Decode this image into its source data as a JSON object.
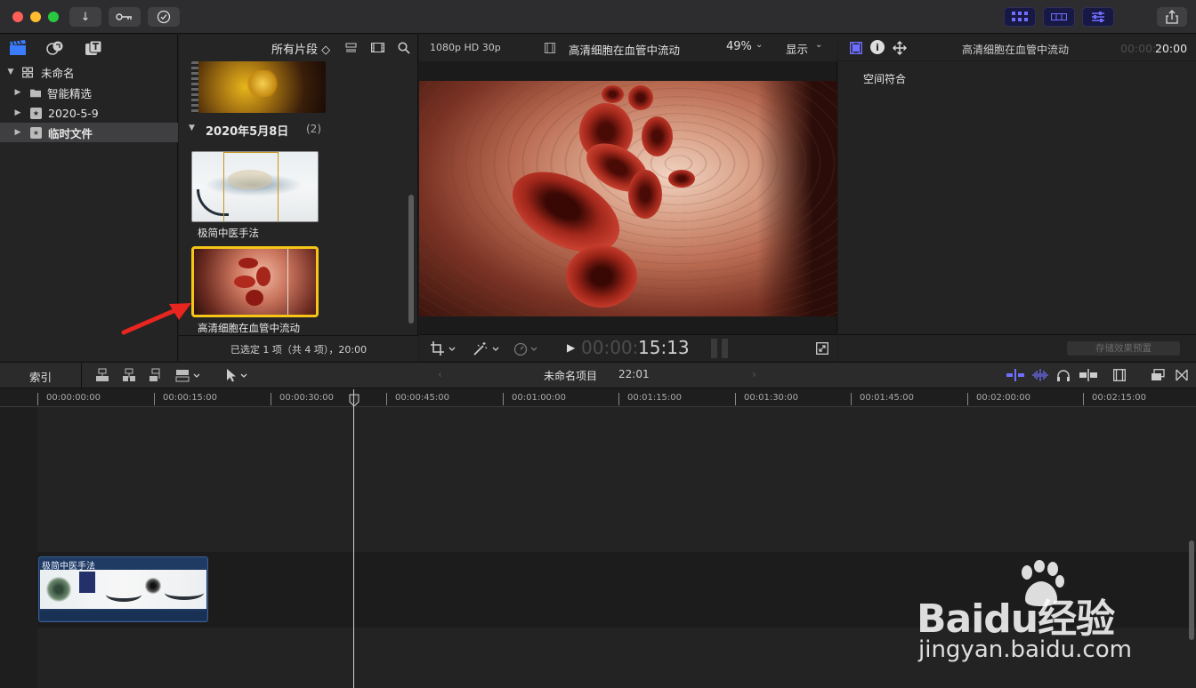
{
  "window": {
    "traffic_colors": [
      "#fe5f57",
      "#febc2e",
      "#28c840"
    ]
  },
  "sidebar": {
    "items": [
      {
        "label": "未命名",
        "icon": "library-grid-icon"
      },
      {
        "label": "智能精选",
        "icon": "folder-icon"
      },
      {
        "label": "2020-5-9",
        "icon": "event-star-icon"
      },
      {
        "label": "临时文件",
        "icon": "event-star-icon"
      }
    ]
  },
  "browser": {
    "filter_label": "所有片段 ◇",
    "date_group": "2020年5月8日",
    "date_group_count": "(2)",
    "clips": [
      {
        "label": "极简中医手法"
      },
      {
        "label": "高清细胞在血管中流动"
      }
    ],
    "status": "已选定 1 项（共 4 项），20:00"
  },
  "viewer": {
    "format": "1080p HD 30p",
    "title": "高清细胞在血管中流动",
    "zoom": "49%",
    "display_label": "显示",
    "timecode_dim": "00:00:",
    "timecode": "15:13"
  },
  "inspector": {
    "title": "高清细胞在血管中流动",
    "duration_dim": "00:00:",
    "duration": "20:00",
    "section": "空间符合",
    "save_preset": "存储效果预置"
  },
  "timeline": {
    "index_label": "索引",
    "project_name": "未命名项目",
    "project_duration": "22:01",
    "ruler_marks": [
      "00:00:00:00",
      "00:00:15:00",
      "00:00:30:00",
      "00:00:45:00",
      "00:01:00:00",
      "00:01:15:00",
      "00:01:30:00",
      "00:01:45:00",
      "00:02:00:00",
      "00:02:15:00"
    ],
    "clip_label": "极简中医手法"
  },
  "watermark": {
    "brand": "Baidu经验",
    "url": "jingyan.baidu.com"
  },
  "colors": {
    "accent": "#6f6fff",
    "selection": "#f5c518",
    "clip_blue": "#1f3a63"
  }
}
